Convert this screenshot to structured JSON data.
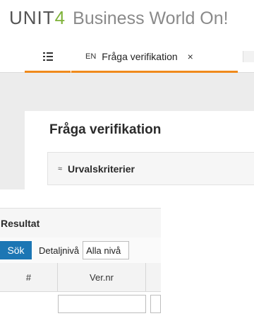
{
  "brand": {
    "mark_main": "UNIT",
    "mark_digit": "4",
    "product": "Business World On!"
  },
  "tabs": {
    "active": {
      "lang": "EN",
      "title": "Fråga verifikation",
      "close": "×"
    }
  },
  "page": {
    "title": "Fråga verifikation",
    "criteria": {
      "toggle": "≈",
      "title": "Urvalskriterier"
    }
  },
  "results": {
    "title": "Resultat",
    "toolbar": {
      "search_label": "Sök",
      "detail_label": "Detaljnivå",
      "detail_value": "Alla nivå"
    },
    "columns": [
      "#",
      "Ver.nr"
    ]
  },
  "colors": {
    "accent": "#f08a1c",
    "button": "#1c76b4",
    "brand_green": "#7fb23a"
  }
}
